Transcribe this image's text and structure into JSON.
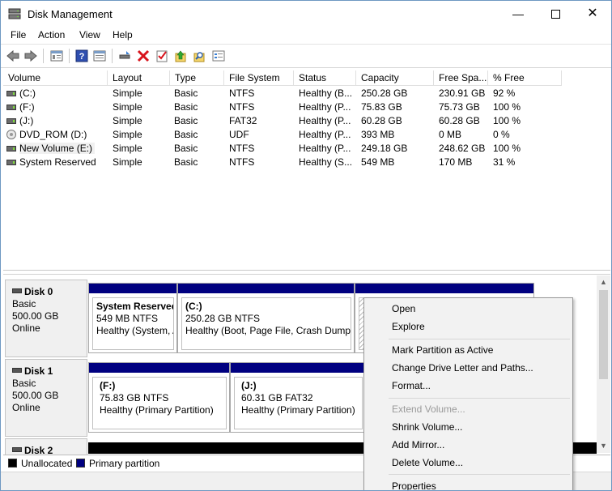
{
  "window": {
    "title": "Disk Management"
  },
  "menu": [
    "File",
    "Action",
    "View",
    "Help"
  ],
  "toolbar_icons": [
    "back-icon",
    "forward-icon",
    "properties-icon",
    "help-icon",
    "view-icon",
    "connect-icon",
    "delete-icon",
    "check-icon",
    "up-icon",
    "search-icon",
    "list-icon"
  ],
  "list": {
    "columns": [
      "Volume",
      "Layout",
      "Type",
      "File System",
      "Status",
      "Capacity",
      "Free Spa...",
      "% Free"
    ],
    "rows": [
      {
        "icon": "drive",
        "volume": "(C:)",
        "layout": "Simple",
        "type": "Basic",
        "fs": "NTFS",
        "status": "Healthy (B...",
        "capacity": "250.28 GB",
        "free": "230.91 GB",
        "pct": "92 %"
      },
      {
        "icon": "drive",
        "volume": "(F:)",
        "layout": "Simple",
        "type": "Basic",
        "fs": "NTFS",
        "status": "Healthy (P...",
        "capacity": "75.83 GB",
        "free": "75.73 GB",
        "pct": "100 %"
      },
      {
        "icon": "drive",
        "volume": "(J:)",
        "layout": "Simple",
        "type": "Basic",
        "fs": "FAT32",
        "status": "Healthy (P...",
        "capacity": "60.28 GB",
        "free": "60.28 GB",
        "pct": "100 %"
      },
      {
        "icon": "cd",
        "volume": "DVD_ROM (D:)",
        "layout": "Simple",
        "type": "Basic",
        "fs": "UDF",
        "status": "Healthy (P...",
        "capacity": "393 MB",
        "free": "0 MB",
        "pct": "0 %"
      },
      {
        "icon": "drive",
        "volume": "New Volume (E:)",
        "layout": "Simple",
        "type": "Basic",
        "fs": "NTFS",
        "status": "Healthy (P...",
        "capacity": "249.18 GB",
        "free": "248.62 GB",
        "pct": "100 %"
      },
      {
        "icon": "drive",
        "volume": "System Reserved",
        "layout": "Simple",
        "type": "Basic",
        "fs": "NTFS",
        "status": "Healthy (S...",
        "capacity": "549 MB",
        "free": "170 MB",
        "pct": "31 %"
      }
    ]
  },
  "disks": [
    {
      "name": "Disk 0",
      "type": "Basic",
      "size": "500.00 GB",
      "state": "Online",
      "partitions": [
        {
          "name": "System Reserved",
          "detail": "549 MB NTFS",
          "status": "Healthy (System, A"
        },
        {
          "name": "(C:)",
          "detail": "250.28 GB NTFS",
          "status": "Healthy (Boot, Page File, Crash Dump,"
        }
      ]
    },
    {
      "name": "Disk 1",
      "type": "Basic",
      "size": "500.00 GB",
      "state": "Online",
      "partitions": [
        {
          "name": "(F:)",
          "detail": "75.83 GB NTFS",
          "status": "Healthy (Primary Partition)"
        },
        {
          "name": "(J:)",
          "detail": "60.31 GB FAT32",
          "status": "Healthy (Primary Partition)"
        }
      ]
    },
    {
      "name": "Disk 2"
    }
  ],
  "legend": [
    {
      "label": "Unallocated",
      "color": "#000000"
    },
    {
      "label": "Primary partition",
      "color": "#000080"
    }
  ],
  "context_menu": {
    "items": [
      {
        "label": "Open",
        "disabled": false
      },
      {
        "label": "Explore",
        "disabled": false
      },
      {
        "label": "Mark Partition as Active",
        "disabled": false
      },
      {
        "label": "Change Drive Letter and Paths...",
        "disabled": false
      },
      {
        "label": "Format...",
        "disabled": false
      },
      {
        "label": "Extend Volume...",
        "disabled": true
      },
      {
        "label": "Shrink Volume...",
        "disabled": false
      },
      {
        "label": "Add Mirror...",
        "disabled": false
      },
      {
        "label": "Delete Volume...",
        "disabled": false
      },
      {
        "label": "Properties",
        "disabled": false
      }
    ]
  },
  "colors": {
    "primary_partition": "#000080",
    "unallocated": "#000000",
    "accent_border": "#6e98c2"
  }
}
